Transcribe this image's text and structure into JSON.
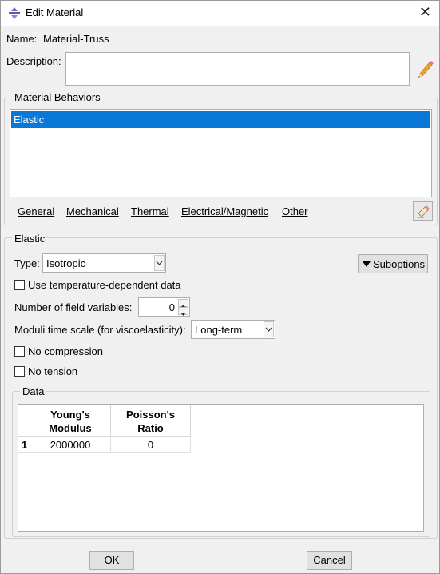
{
  "window": {
    "title": "Edit Material",
    "close_glyph": "✕"
  },
  "name": {
    "label": "Name:",
    "value": "Material-Truss"
  },
  "description": {
    "label": "Description:",
    "value": "",
    "edit_icon": "pencil-icon"
  },
  "behaviors": {
    "title": "Material Behaviors",
    "items": [
      "Elastic"
    ],
    "selected": "Elastic",
    "menus": [
      "General",
      "Mechanical",
      "Thermal",
      "Electrical/Magnetic",
      "Other"
    ],
    "delete_icon": "eraser-icon"
  },
  "elastic": {
    "title": "Elastic",
    "type_label": "Type:",
    "type_value": "Isotropic",
    "suboptions_label": "Suboptions",
    "temp_dependent_label": "Use temperature-dependent data",
    "temp_dependent_checked": false,
    "field_vars_label": "Number of field variables:",
    "field_vars_value": "0",
    "moduli_label": "Moduli time scale (for viscoelasticity):",
    "moduli_value": "Long-term",
    "no_compression_label": "No compression",
    "no_compression_checked": false,
    "no_tension_label": "No tension",
    "no_tension_checked": false
  },
  "data_table": {
    "title": "Data",
    "columns": [
      {
        "line1": "Young's",
        "line2": "Modulus"
      },
      {
        "line1": "Poisson's",
        "line2": "Ratio"
      }
    ],
    "rows": [
      {
        "index": "1",
        "cells": [
          "2000000",
          "0"
        ]
      }
    ]
  },
  "buttons": {
    "ok": "OK",
    "cancel": "Cancel"
  }
}
